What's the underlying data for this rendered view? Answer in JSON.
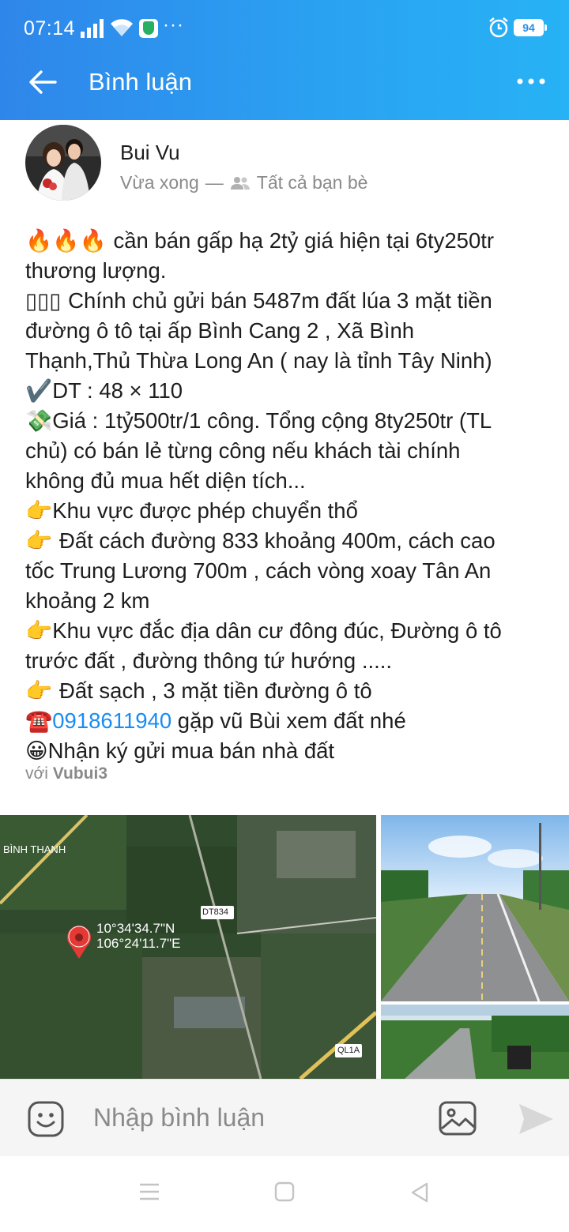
{
  "status_bar": {
    "time": "07:14",
    "battery": "94",
    "more": "···"
  },
  "header": {
    "title": "Bình luận"
  },
  "post": {
    "author": "Bui Vu",
    "time": "Vừa xong",
    "separator": "—",
    "privacy": "Tất cả bạn bè",
    "lines": [
      {
        "prefix": "🔥🔥🔥 ",
        "text": "cần bán gấp hạ 2tỷ giá hiện tại 6ty250tr"
      },
      {
        "prefix": "",
        "text": "thương lượng."
      },
      {
        "prefix": "▯▯▯ ",
        "text": "Chính chủ gửi bán 5487m đất lúa 3 mặt tiền"
      },
      {
        "prefix": "",
        "text": "đường ô tô tại ấp Bình Cang 2 , Xã Bình"
      },
      {
        "prefix": "",
        "text": "Thạnh,Thủ Thừa Long An ( nay là tỉnh Tây Ninh)"
      },
      {
        "prefix": "✔️",
        "text": "DT : 48 × 110"
      },
      {
        "prefix": "💸",
        "text": "Giá : 1tỷ500tr/1 công. Tổng cộng 8ty250tr (TL"
      },
      {
        "prefix": "",
        "text": "chủ) có bán lẻ từng công nếu khách tài chính"
      },
      {
        "prefix": "",
        "text": "không đủ mua hết diện tích..."
      },
      {
        "prefix": "👉",
        "text": "Khu vực được phép chuyển thổ"
      },
      {
        "prefix": "👉 ",
        "text": "Đất cách đường 833 khoảng 400m, cách cao"
      },
      {
        "prefix": "",
        "text": "tốc Trung Lương 700m , cách vòng xoay Tân An"
      },
      {
        "prefix": "",
        "text": "khoảng 2 km"
      },
      {
        "prefix": "👉",
        "text": "Khu vực đắc địa dân cư đông đúc, Đường ô tô"
      },
      {
        "prefix": "",
        "text": "trước đất , đường thông tứ hướng ....."
      },
      {
        "prefix": "👉 ",
        "text": "Đất sạch , 3 mặt tiền đường ô tô"
      }
    ],
    "phone_prefix": "☎️",
    "phone": "0918611940",
    "phone_suffix": " gặp vũ Bùi xem đất nhé",
    "last_prefix": "😀",
    "last_line": "Nhận ký gửi mua bán nhà đất",
    "with_label": "với",
    "with_user": "Vubui3"
  },
  "map": {
    "place": "BÌNH THẠNH",
    "road1": "DT834",
    "road2": "QL1A",
    "lat": "10°34'34.7\"N",
    "lon": "106°24'11.7\"E"
  },
  "comment_bar": {
    "placeholder": "Nhập bình luận"
  },
  "colors": {
    "header_start": "#2f86ea",
    "header_end": "#27b2f5",
    "link": "#1a8cf2",
    "map_pin": "#e53935"
  }
}
